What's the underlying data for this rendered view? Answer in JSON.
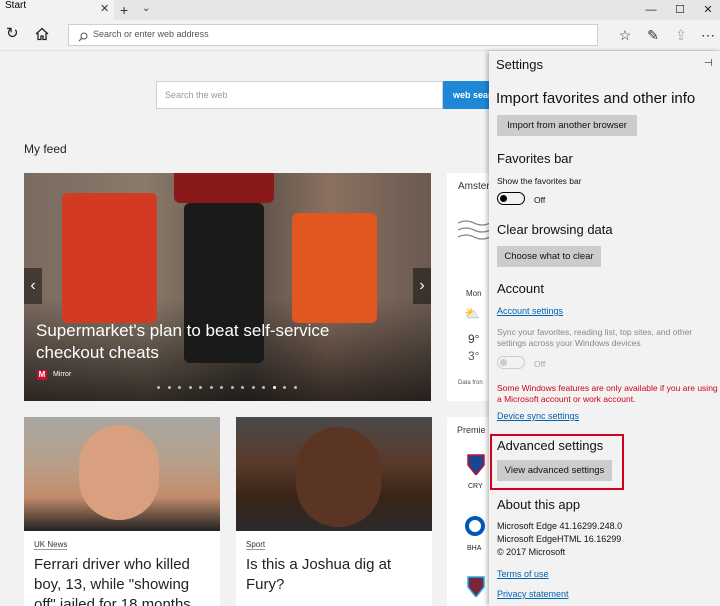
{
  "browser": {
    "tab_title": "Start",
    "address_placeholder": "Search or enter web address"
  },
  "start_page": {
    "search_placeholder": "Search the web",
    "search_button": "web sear",
    "feed_title": "My feed",
    "hero": {
      "headline": "Supermarket's plan to beat self-service checkout cheats",
      "source_icon": "M",
      "source": "Mirror",
      "slide_count": 14,
      "active_slide": 11
    },
    "cards": [
      {
        "category": "UK News",
        "title": "Ferrari driver who killed boy, 13, while \"showing off\" jailed for 18 months"
      },
      {
        "category": "Sport",
        "title": "Is this a Joshua dig at Fury?"
      }
    ],
    "weather": {
      "location": "Amster",
      "day": "Mon",
      "high": "9°",
      "low": "3°",
      "footer": "Data fron"
    },
    "premier": {
      "title": "Premie",
      "teams": [
        "CRY",
        "BHA"
      ]
    }
  },
  "settings": {
    "title": "Settings",
    "import_heading": "Import favorites and other info",
    "import_button": "Import from another browser",
    "favbar_heading": "Favorites bar",
    "favbar_label": "Show the favorites bar",
    "favbar_state": "Off",
    "clear_heading": "Clear browsing data",
    "clear_button": "Choose what to clear",
    "account_heading": "Account",
    "account_link": "Account settings",
    "sync_text": "Sync your favorites, reading list, top sites, and other settings across your Windows devices",
    "sync_state": "Off",
    "warning_text": "Some Windows features are only available if you are using a Microsoft account or work account.",
    "device_sync_link": "Device sync settings",
    "advanced_heading": "Advanced settings",
    "advanced_button": "View advanced settings",
    "about_heading": "About this app",
    "about_line1": "Microsoft Edge 41.16299.248.0",
    "about_line2": "Microsoft EdgeHTML 16.16299",
    "about_line3": "© 2017 Microsoft",
    "terms_link": "Terms of use",
    "privacy_link": "Privacy statement",
    "warning_color": "#d0021b",
    "link_color": "#0063b1"
  }
}
